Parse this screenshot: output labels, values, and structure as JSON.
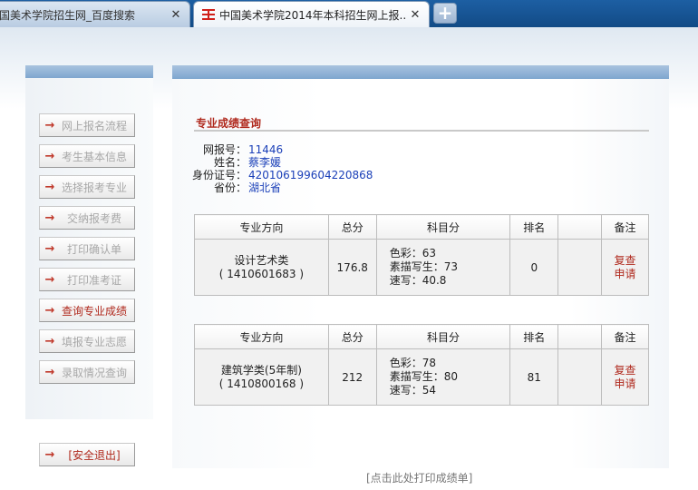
{
  "browser": {
    "tabs": [
      {
        "title": "国美术学院招生网_百度搜索",
        "close": "✕"
      },
      {
        "title": "中国美术学院2014年本科招生网上报...",
        "close": "✕"
      }
    ],
    "new_tab": "+"
  },
  "sidebar": {
    "items": [
      {
        "label": "网上报名流程",
        "state": "disabled"
      },
      {
        "label": "考生基本信息",
        "state": "disabled"
      },
      {
        "label": "选择报考专业",
        "state": "disabled"
      },
      {
        "label": "交纳报考费",
        "state": "disabled"
      },
      {
        "label": "打印确认单",
        "state": "disabled"
      },
      {
        "label": "打印准考证",
        "state": "disabled"
      },
      {
        "label": "查询专业成绩",
        "state": "active"
      },
      {
        "label": "填报专业志愿",
        "state": "disabled"
      },
      {
        "label": "录取情况查询",
        "state": "disabled"
      }
    ],
    "logout": "[安全退出]",
    "arrow": "→"
  },
  "main": {
    "title": "专业成绩查询",
    "info": {
      "reg_label": "网报号：",
      "reg_value": "11446",
      "name_label": "姓名：",
      "name_value": "蔡李媛",
      "id_label": "身份证号：",
      "id_value": "420106199604220868",
      "province_label": "省份：",
      "province_value": "湖北省"
    },
    "table_headers": [
      "专业方向",
      "总分",
      "科目分",
      "排名",
      "",
      "备注"
    ],
    "results": [
      {
        "major": "设计艺术类",
        "code": "( 1410601683 )",
        "total": "176.8",
        "subjects": [
          "色彩：63",
          "素描写生：73",
          "速写：40.8"
        ],
        "rank": "0",
        "extra": "",
        "remark": [
          "复查",
          "申请"
        ]
      },
      {
        "major": "建筑学类(5年制)",
        "code": "( 1410800168 )",
        "total": "212",
        "subjects": [
          "色彩：78",
          "素描写生：80",
          "速写：54"
        ],
        "rank": "81",
        "extra": "",
        "remark": [
          "复查",
          "申请"
        ]
      }
    ],
    "print_link": "[点击此处打印成绩单]"
  },
  "colors": {
    "accent_red": "#b02a1e",
    "link_blue": "#1a3fb8",
    "header_bar": "#7ea6cf",
    "tabbar": "#124b86"
  }
}
